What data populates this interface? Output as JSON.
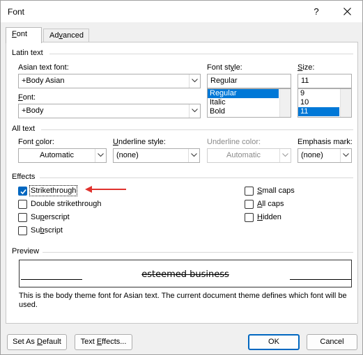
{
  "window": {
    "title": "Font",
    "help_label": "?"
  },
  "tabs": [
    {
      "label": "Font",
      "mnemonic_prefix": "F",
      "rest": "ont"
    },
    {
      "label": "Advanced",
      "prefix": "Ad",
      "mnemonic": "v",
      "rest": "anced"
    }
  ],
  "latin_text": {
    "heading": "Latin text",
    "asian_font_label_pre": "Asian text font:",
    "asian_font_value": "+Body Asian",
    "font_label_mn": "F",
    "font_label_rest": "ont:",
    "font_value": "+Body",
    "style_label_pre": "Font st",
    "style_label_mn": "y",
    "style_label_post": "le:",
    "style_value": "Regular",
    "style_options": [
      "Regular",
      "Italic",
      "Bold"
    ],
    "size_label_mn": "S",
    "size_label_rest": "ize:",
    "size_value": "11",
    "size_options": [
      "9",
      "10",
      "11"
    ]
  },
  "all_text": {
    "heading": "All text",
    "font_color_label_pre": "Font ",
    "font_color_label_mn": "c",
    "font_color_label_post": "olor:",
    "font_color_value": "Automatic",
    "underline_style_label_mn": "U",
    "underline_style_label_rest": "nderline style:",
    "underline_style_value": "(none)",
    "underline_color_label": "Underline color:",
    "underline_color_value": "Automatic",
    "emphasis_label": "Emphasis mark:",
    "emphasis_value": "(none)"
  },
  "effects": {
    "heading": "Effects",
    "strikethrough": {
      "label_mn": "K",
      "label": "Strikethrough",
      "checked": true
    },
    "double_strikethrough": {
      "label": "Double strikethrough",
      "checked": false
    },
    "superscript": {
      "label_pre": "Su",
      "label_mn": "p",
      "label_post": "erscript",
      "checked": false
    },
    "subscript": {
      "label_pre": "Su",
      "label_mn": "b",
      "label_post": "script",
      "checked": false
    },
    "small_caps": {
      "label_mn": "S",
      "label_rest": "mall caps",
      "checked": false
    },
    "all_caps": {
      "label_mn": "A",
      "label_rest": "ll caps",
      "checked": false
    },
    "hidden": {
      "label_mn": "H",
      "label_rest": "idden",
      "checked": false
    },
    "annotation_arrow_color": "#e0322e"
  },
  "preview": {
    "heading": "Preview",
    "sample_text": "esteemed business",
    "description": "This is the body theme font for Asian text. The current document theme defines which font will be used."
  },
  "buttons": {
    "set_default_pre": "Set As ",
    "set_default_mn": "D",
    "set_default_post": "efault",
    "text_effects_pre": "Text ",
    "text_effects_mn": "E",
    "text_effects_post": "ffects...",
    "ok": "OK",
    "cancel": "Cancel"
  },
  "colors": {
    "accent": "#0067c0",
    "selection": "#0078d7"
  }
}
